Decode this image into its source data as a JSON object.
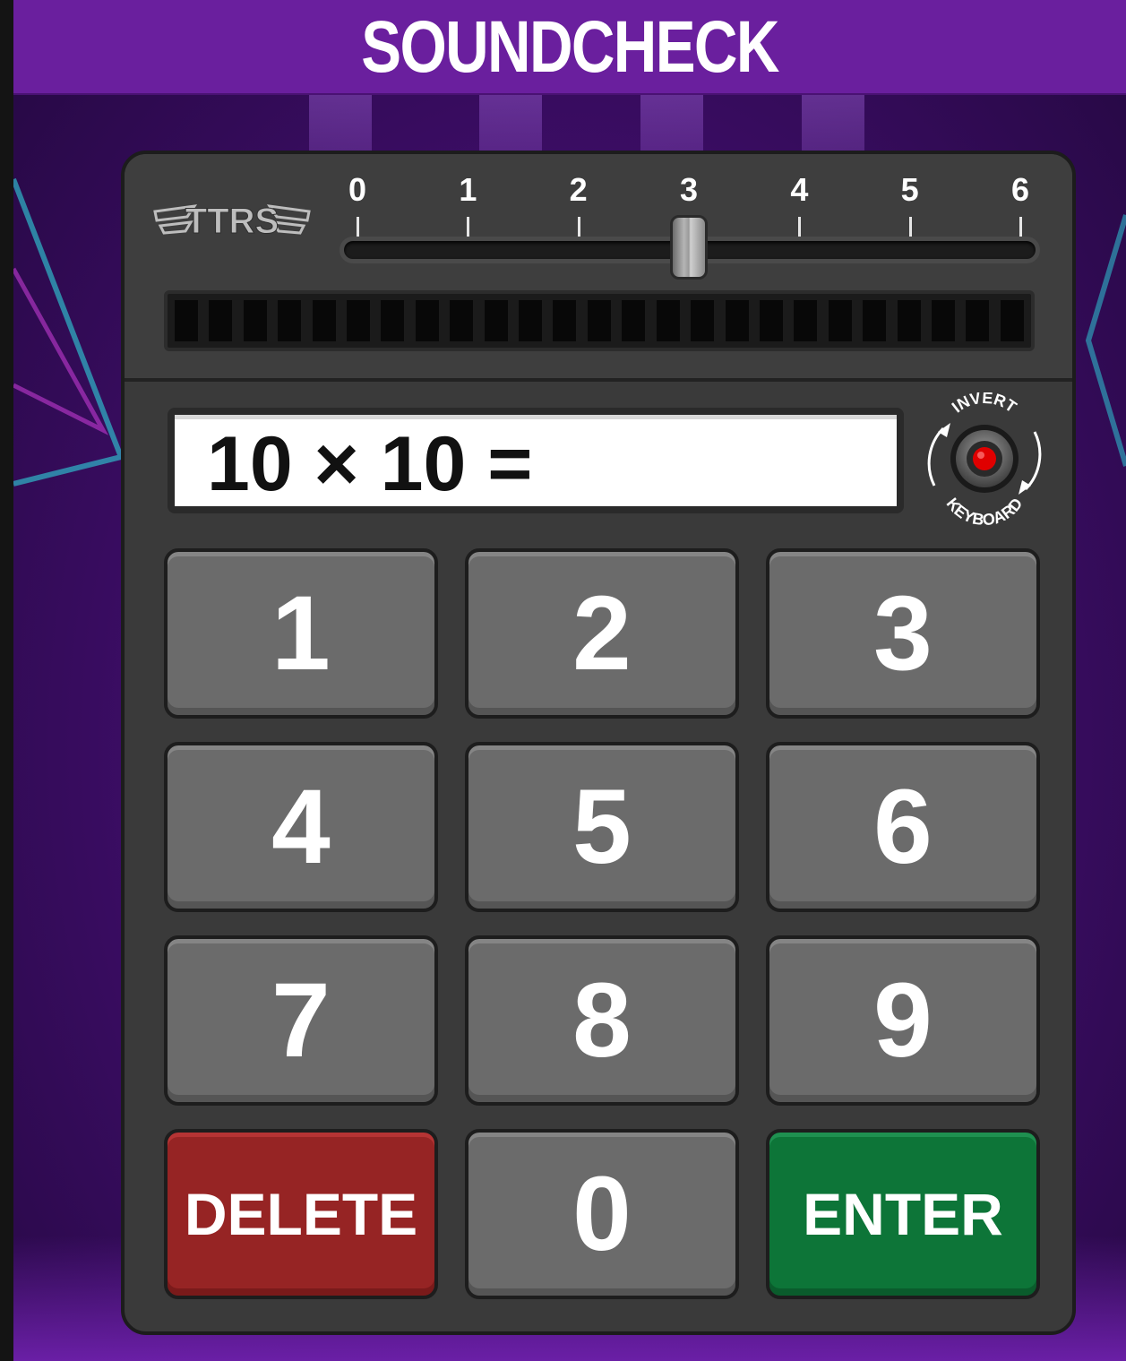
{
  "header": {
    "title": "SOUNDCHECK"
  },
  "logo": {
    "text": "TTRS"
  },
  "timer_slider": {
    "ticks": [
      "0",
      "1",
      "2",
      "3",
      "4",
      "5",
      "6"
    ],
    "value": 3
  },
  "progress_meter": {
    "segments": 25,
    "filled": 0
  },
  "question": {
    "text": "10 × 10 ="
  },
  "invert_keyboard": {
    "top_label": "INVERT",
    "bottom_label": "KEYBOARD",
    "indicator_color": "#e00000"
  },
  "keypad": {
    "k1": "1",
    "k2": "2",
    "k3": "3",
    "k4": "4",
    "k5": "5",
    "k6": "6",
    "k7": "7",
    "k8": "8",
    "k9": "9",
    "delete": "DELETE",
    "k0": "0",
    "enter": "ENTER"
  },
  "colors": {
    "background_purple": "#5d1a92",
    "header_purple": "#6a1f9e",
    "delete_red": "#962424",
    "enter_green": "#0d7538",
    "key_gray": "#6b6b6b"
  }
}
